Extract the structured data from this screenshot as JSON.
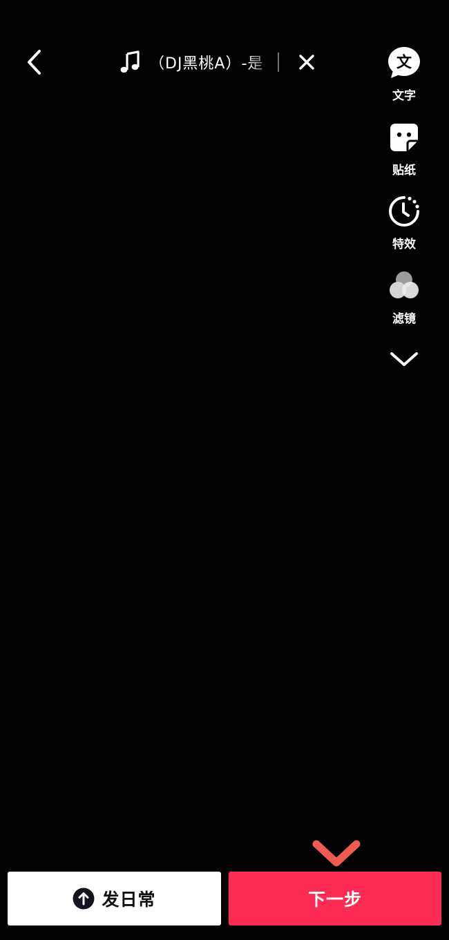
{
  "music": {
    "title": "（DJ黑桃A）-是"
  },
  "tools": {
    "text_label": "文字",
    "text_icon_glyph": "文",
    "sticker_label": "贴纸",
    "effect_label": "特效",
    "filter_label": "滤镜"
  },
  "bottom": {
    "daily_label": "发日常",
    "next_label": "下一步"
  },
  "colors": {
    "background": "#020202",
    "primary_button": "#fe2c55",
    "annotation_arrow": "#f0504e"
  }
}
